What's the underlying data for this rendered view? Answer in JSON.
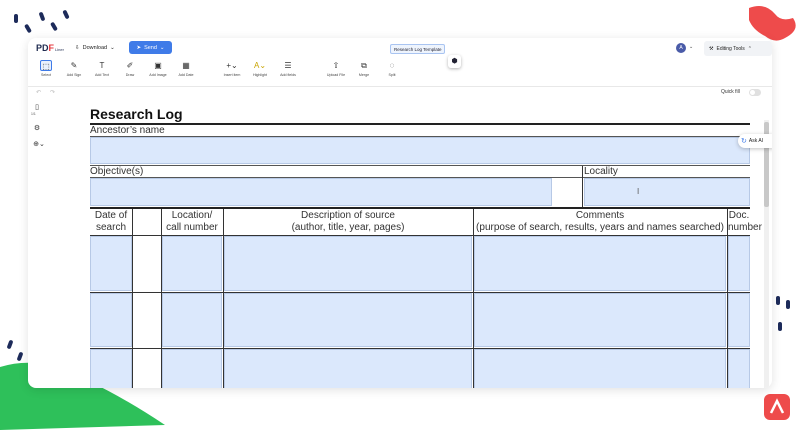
{
  "app": {
    "logo": {
      "brand_a": "PD",
      "brand_b": "F",
      "brand_c": "Liner"
    },
    "download_label": "Download",
    "send_label": "Send",
    "document_name": "Research Log Template",
    "avatar_initial": "A",
    "editing_tools_label": "Editing Tools",
    "quick_fill_label": "Quick fill",
    "ask_ai_label": "Ask AI"
  },
  "toolbar": {
    "tools": [
      {
        "label": "Select",
        "icon": "select-icon"
      },
      {
        "label": "Add Sign",
        "icon": "sign-icon"
      },
      {
        "label": "Add Text",
        "icon": "text-icon"
      },
      {
        "label": "Draw",
        "icon": "draw-icon"
      },
      {
        "label": "Add Image",
        "icon": "image-icon"
      },
      {
        "label": "Add Date",
        "icon": "calendar-icon"
      },
      {
        "label": "Insert item",
        "icon": "plus-icon"
      },
      {
        "label": "Highlight",
        "icon": "highlight-icon"
      },
      {
        "label": "Add fields",
        "icon": "fields-icon"
      },
      {
        "label": "Upload File",
        "icon": "upload-icon"
      },
      {
        "label": "Merge",
        "icon": "merge-icon"
      },
      {
        "label": "Split",
        "icon": "split-icon"
      }
    ]
  },
  "sidebar": {
    "page_label": "1/1"
  },
  "document": {
    "title": "Research Log",
    "ancestor_label": "Ancestor’s name",
    "objective_label": "Objective(s)",
    "locality_label": "Locality",
    "columns": [
      {
        "line1": "Date of",
        "line2": "search"
      },
      {
        "line1": "Location/",
        "line2": "call number"
      },
      {
        "line1": "Description of source",
        "line2": "(author, title, year, pages)"
      },
      {
        "line1": "Comments",
        "line2": "(purpose of search, results, years and names searched)"
      },
      {
        "line1": "Doc.",
        "line2": "number"
      }
    ]
  },
  "colors": {
    "accent": "#3f7be8",
    "field_fill": "#dbe8fc",
    "brand_red": "#e6373c",
    "deco_green": "#2ec05a"
  }
}
